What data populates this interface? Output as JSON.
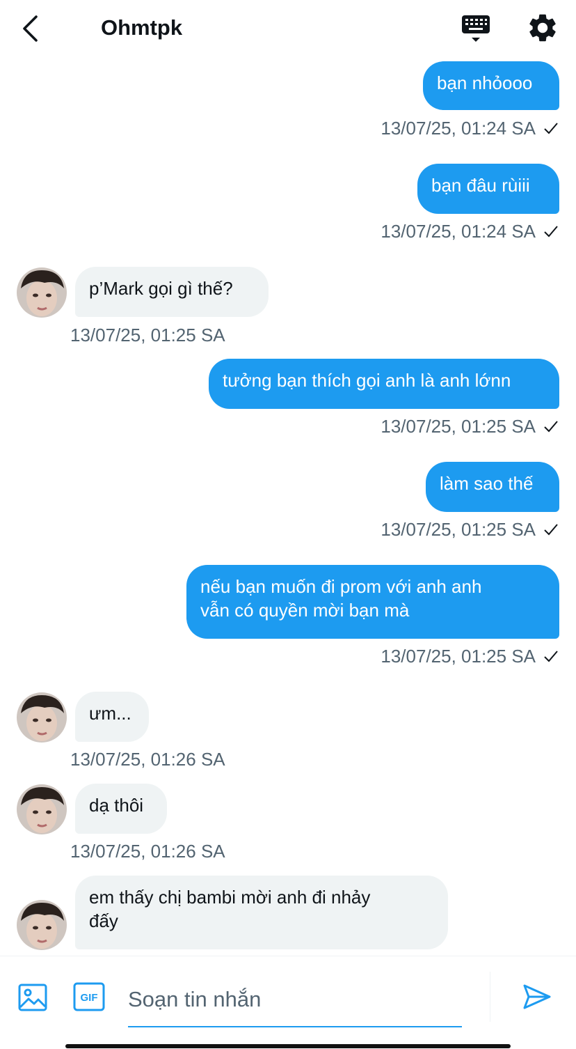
{
  "header": {
    "title": "Ohmtpk",
    "icons": {
      "back": "chevron-left-icon",
      "keyboard": "keyboard-icon",
      "settings": "gear-icon"
    }
  },
  "messages": [
    {
      "direction": "out",
      "text": "bạn nhỏooo",
      "time": "13/07/25, 01:24 SA",
      "read_check": true
    },
    {
      "direction": "out",
      "text": "bạn đâu rùiii",
      "time": "13/07/25, 01:24 SA",
      "read_check": true
    },
    {
      "direction": "in",
      "text": "p’Mark gọi gì thế?",
      "time": "13/07/25, 01:25 SA"
    },
    {
      "direction": "out",
      "text": "tưởng bạn thích gọi anh là anh lớnn",
      "time": "13/07/25, 01:25 SA",
      "read_check": true
    },
    {
      "direction": "out",
      "text": "làm sao thế",
      "time": "13/07/25, 01:25 SA",
      "read_check": true
    },
    {
      "direction": "out",
      "text": "nếu bạn muốn đi prom với anh anh\nvẫn có quyền mời bạn mà",
      "time": "13/07/25, 01:25 SA",
      "read_check": true
    },
    {
      "direction": "in",
      "text": "ưm...",
      "time": "13/07/25, 01:26 SA"
    },
    {
      "direction": "in",
      "text": "dạ thôi",
      "time": "13/07/25, 01:26 SA"
    },
    {
      "direction": "in",
      "text": "em thấy chị bambi mời anh đi nhảy\nđấy"
    }
  ],
  "composer": {
    "placeholder": "Soạn tin nhắn",
    "icons": {
      "image": "image-icon",
      "gif": "gif-icon",
      "send": "send-icon"
    },
    "gif_label": "GIF"
  },
  "colors": {
    "accent": "#1d9bf0",
    "incoming_bubble": "#eff3f4",
    "timestamp": "#536471"
  }
}
